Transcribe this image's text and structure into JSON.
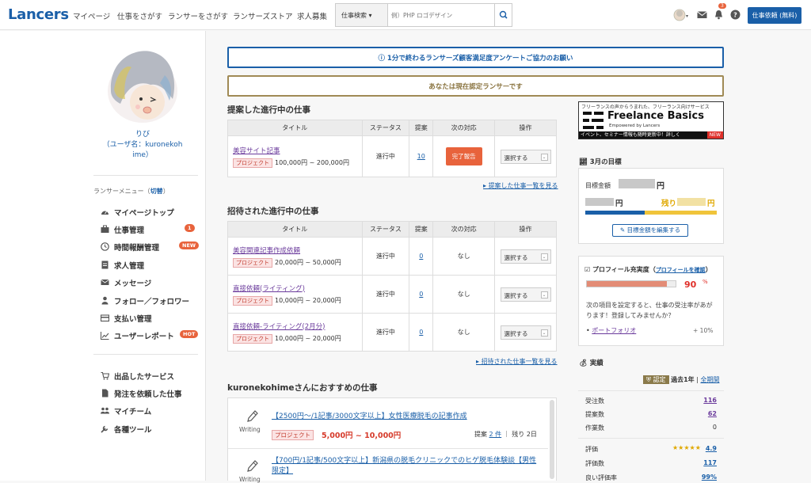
{
  "header": {
    "logo": "Lancers",
    "nav": [
      "マイページ",
      "仕事をさがす",
      "ランサーをさがす",
      "ランサーズストア",
      "求人募集"
    ],
    "search_category": "仕事検索 ▾",
    "search_placeholder": "例）PHP ロゴデザイン",
    "notif_count": "3",
    "order_button": "仕事依頼 (無料)",
    "icons": [
      "avatar-icon",
      "mail-icon",
      "bell-icon",
      "help-icon",
      "search-icon"
    ]
  },
  "sidebar": {
    "user_name": "りび",
    "user_id_line1": "（ユーザ名：kuronekoh",
    "user_id_line2": "ime）",
    "menu_head": "ランサーメニュー（",
    "menu_switch": "切替",
    "menu_head_end": "）",
    "items": [
      {
        "label": "マイページトップ",
        "icon": "dashboard-icon",
        "badge": ""
      },
      {
        "label": "仕事管理",
        "icon": "briefcase-icon",
        "badge": "1"
      },
      {
        "label": "時間報酬管理",
        "icon": "clock-icon",
        "badge": "NEW"
      },
      {
        "label": "求人管理",
        "icon": "document-icon",
        "badge": ""
      },
      {
        "label": "メッセージ",
        "icon": "mail-icon",
        "badge": ""
      },
      {
        "label": "フォロー／フォロワー",
        "icon": "person-icon",
        "badge": ""
      },
      {
        "label": "支払い管理",
        "icon": "card-icon",
        "badge": ""
      },
      {
        "label": "ユーザーレポート",
        "icon": "chart-icon",
        "badge": "HOT"
      }
    ],
    "items2": [
      {
        "label": "出品したサービス",
        "icon": "cart-icon"
      },
      {
        "label": "発注を依頼した仕事",
        "icon": "file-icon"
      },
      {
        "label": "マイチーム",
        "icon": "team-icon"
      },
      {
        "label": "各種ツール",
        "icon": "wrench-icon"
      }
    ]
  },
  "banners": {
    "survey": "1分で終わるランサーズ顧客満足度アンケートご協力のお願い",
    "certified": "あなたは現在認定ランサーです"
  },
  "proposed": {
    "heading": "提案した進行中の仕事",
    "headers": [
      "タイトル",
      "ステータス",
      "提案",
      "次の対応",
      "操作"
    ],
    "rows": [
      {
        "title": "美容サイト記事",
        "tag": "プロジェクト",
        "price": "100,000円 ~ 200,000円",
        "status": "進行中",
        "count": "10",
        "action": "完了報告",
        "select": "選択する"
      }
    ],
    "more": "提案した仕事一覧を見る"
  },
  "invited": {
    "heading": "招待された進行中の仕事",
    "headers": [
      "タイトル",
      "ステータス",
      "提案",
      "次の対応",
      "操作"
    ],
    "rows": [
      {
        "title": "美容関連記事作成依頼",
        "tag": "プロジェクト",
        "price": "20,000円 ~ 50,000円",
        "status": "進行中",
        "count": "0",
        "action": "なし",
        "select": "選択する"
      },
      {
        "title": "直接依頼(ライティング)",
        "tag": "プロジェクト",
        "price": "10,000円 ~ 20,000円",
        "status": "進行中",
        "count": "0",
        "action": "なし",
        "select": "選択する"
      },
      {
        "title": "直接依頼-ライティング(2月分)",
        "tag": "プロジェクト",
        "price": "10,000円 ~ 20,000円",
        "status": "進行中",
        "count": "0",
        "action": "なし",
        "select": "選択する"
      }
    ],
    "more": "招待された仕事一覧を見る"
  },
  "recommend": {
    "heading": "kuronekohimeさんにおすすめの仕事",
    "items": [
      {
        "category": "Writing",
        "title": "【2500円〜/1記事/3000文字以上】女性医療脱毛の記事作成",
        "tag": "プロジェクト",
        "price": "5,000円 ~ 10,000円",
        "proposal_label": "提案",
        "proposal_count": "2 件",
        "remaining": "残り 2日"
      },
      {
        "category": "Writing",
        "title": "【700円/1記事/500文字以上】新潟県の脱毛クリニックでのヒゲ脱毛体験談【男性限定】"
      }
    ]
  },
  "freelance_basics": {
    "tagline": "フリーランスの声からうまれた、フリーランス向けサービス",
    "title": "Freelance Basics",
    "sub": "Empowered by Lancers",
    "footer": "イベント、セミナー情報も随時更新中！詳しく",
    "new": "NEW"
  },
  "goal": {
    "heading": "3月の目標",
    "target_label": "目標金額",
    "target_value": "円",
    "earned_value": "円",
    "remaining_label": "残り",
    "remaining_value": "円",
    "edit_button": "目標金額を編集する",
    "progress": 0.45
  },
  "profile": {
    "heading": "プロフィール充実度",
    "link": "プロフィールを確認",
    "percent": "90",
    "percent_unit": "%",
    "progress": 0.9,
    "desc": "次の項目を設定すると、仕事の受注率があがります！登録してみませんか？",
    "item": "ポートフォリオ",
    "item_gain": "+ 10%"
  },
  "stats": {
    "heading": "実績",
    "certified": "認定",
    "period": "過去1年",
    "all": "全期間",
    "rows": [
      {
        "label": "受注数",
        "value": "116"
      },
      {
        "label": "提案数",
        "value": "62"
      },
      {
        "label": "作業数",
        "value": "0"
      }
    ],
    "rating_label": "評価",
    "rating_value": "4.9",
    "rating_count_label": "評価数",
    "rating_count": "117",
    "good_label": "良い評価率",
    "good_value": "99%"
  }
}
